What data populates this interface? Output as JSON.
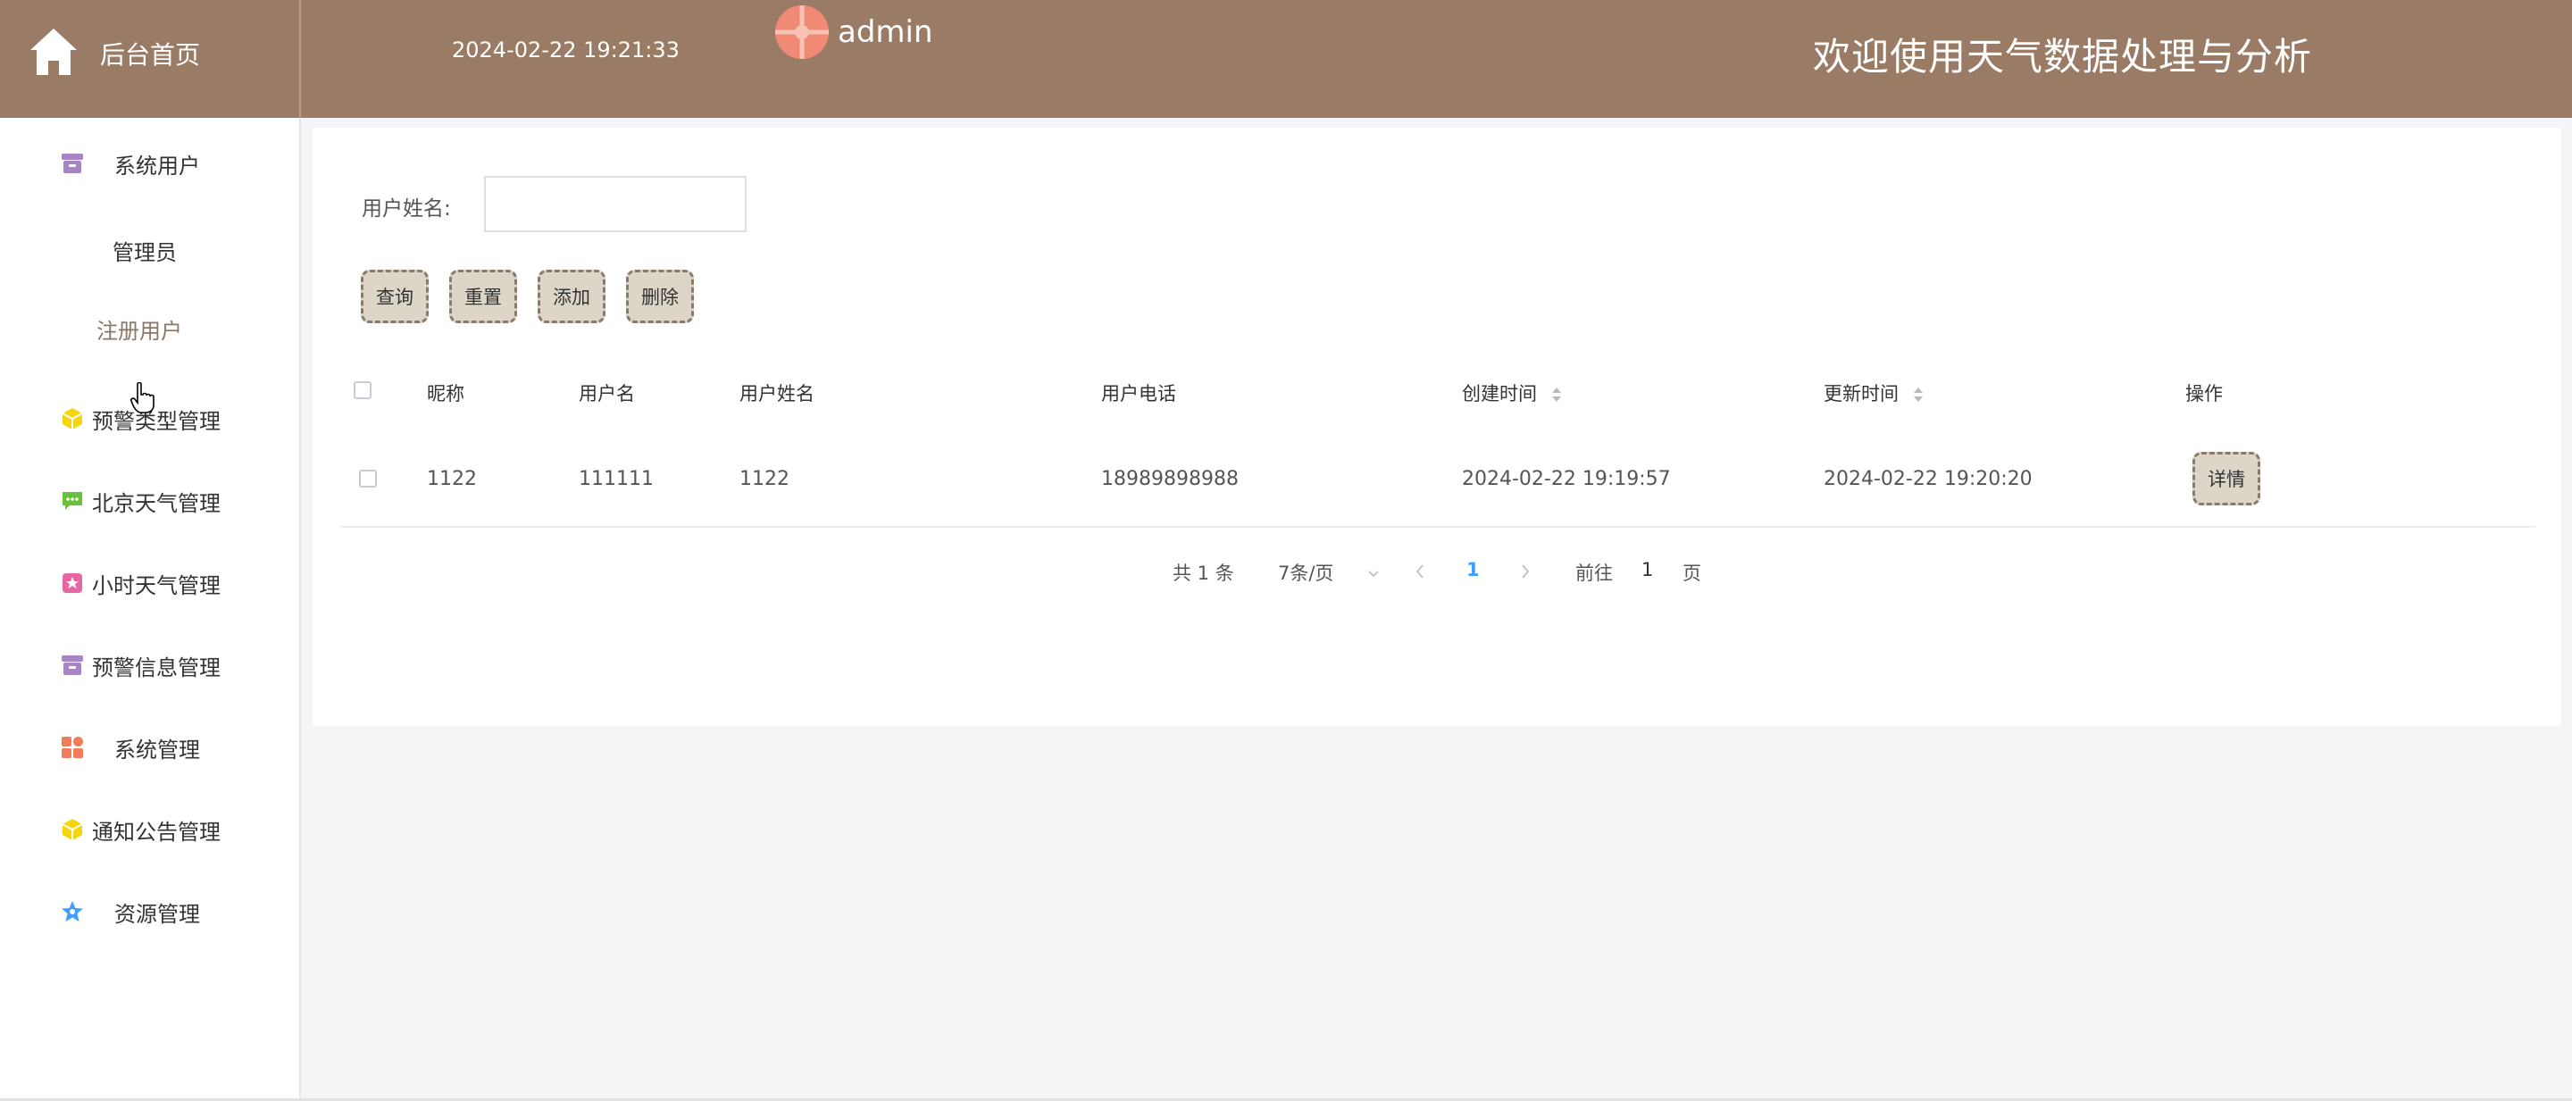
{
  "header": {
    "home_label": "后台首页",
    "datetime": "2024-02-22 19:21:33",
    "username": "admin",
    "welcome": "欢迎使用天气数据处理与分析"
  },
  "sidebar": {
    "items": [
      {
        "label": "系统用户",
        "icon": "archive-icon",
        "color": "#a883c5"
      },
      {
        "label": "管理员"
      },
      {
        "label": "注册用户"
      },
      {
        "label": "预警类型管理",
        "icon": "cube-icon",
        "color": "#f5d50e"
      },
      {
        "label": "北京天气管理",
        "icon": "chat-icon",
        "color": "#67c23a"
      },
      {
        "label": "小时天气管理",
        "icon": "badge-icon",
        "color": "#e667a1"
      },
      {
        "label": "预警信息管理",
        "icon": "archive-icon",
        "color": "#a883c5"
      },
      {
        "label": "系统管理",
        "icon": "grid-icon",
        "color": "#f07c5a"
      },
      {
        "label": "通知公告管理",
        "icon": "cube-icon",
        "color": "#f5d50e"
      },
      {
        "label": "资源管理",
        "icon": "star-icon",
        "color": "#409eff"
      }
    ]
  },
  "search": {
    "label": "用户姓名:",
    "value": "",
    "placeholder": ""
  },
  "toolbar": {
    "query": "查询",
    "reset": "重置",
    "add": "添加",
    "delete": "删除"
  },
  "table": {
    "headers": {
      "nickname": "昵称",
      "username": "用户名",
      "realname": "用户姓名",
      "phone": "用户电话",
      "created": "创建时间",
      "updated": "更新时间",
      "action": "操作"
    },
    "rows": [
      {
        "nickname": "1122",
        "username": "111111",
        "realname": "1122",
        "phone": "18989898988",
        "created": "2024-02-22 19:19:57",
        "updated": "2024-02-22 19:20:20",
        "action": "详情"
      }
    ]
  },
  "pagination": {
    "total": "共 1 条",
    "page_size": "7条/页",
    "current_page": "1",
    "goto_prefix": "前往",
    "goto_value": "1",
    "goto_suffix": "页"
  },
  "colors": {
    "header_bg": "#9a7c66",
    "button_bg": "#ddd6c8",
    "accent": "#409eff"
  }
}
